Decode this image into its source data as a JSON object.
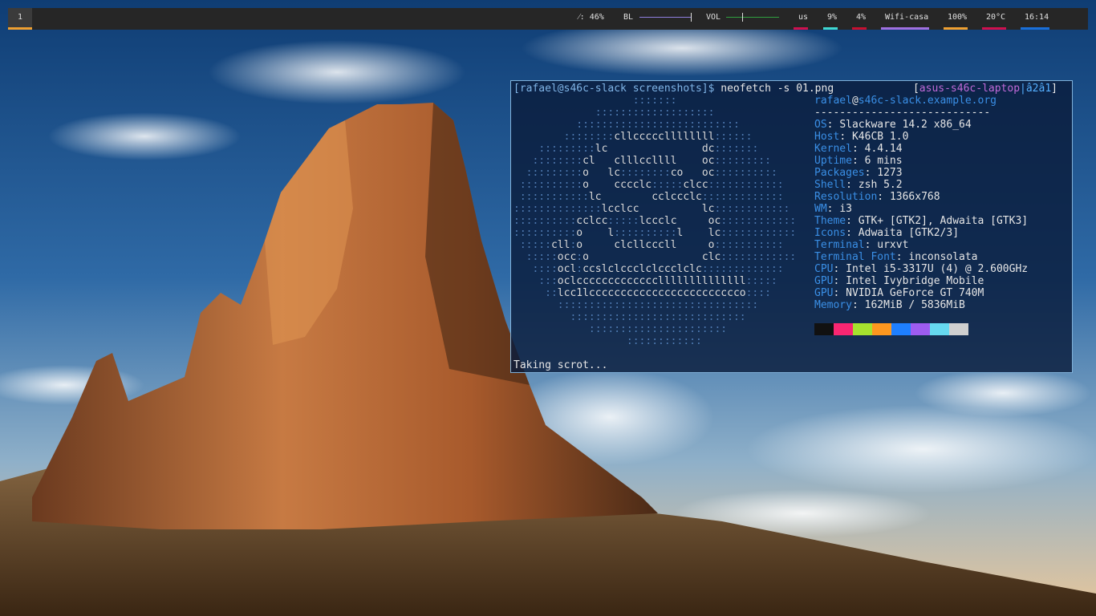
{
  "statusbar": {
    "workspace": "1",
    "brightness": "⁄: 46%",
    "backlight_label": "BL",
    "volume_label": "VOL",
    "keyboard_layout": "us",
    "cpu": "9%",
    "mem": "4%",
    "wifi": "Wifi-casa",
    "battery": "100%",
    "temp": "20°C",
    "clock": "16:14",
    "backlight_level": 1.0,
    "volume_level": 0.3,
    "colors": {
      "workspace_accent": "#f0a030",
      "us": "#d0104c",
      "cpu": "#40d8d0",
      "mem": "#c8102e",
      "wifi": "#a070e0",
      "battery": "#f0a030",
      "temp": "#d0104c",
      "clock": "#1a6fd8",
      "backlight_slider": "#9080e0",
      "volume_slider": "#30a040"
    }
  },
  "terminal": {
    "prompt_user": "[rafael@s46c-slack screenshots]$",
    "command": " neofetch -s 01.png",
    "host_badge_open": "[",
    "host_badge_name": "asus-s46c-laptop",
    "host_badge_sep": "|",
    "host_badge_num": "â2â1",
    "host_badge_close": "]",
    "status_message": "Taking scrot...",
    "ascii_logo": [
      {
        "a": "                   ",
        "b": ":::::::"
      },
      {
        "a": "             ",
        "b": ":::::::::::::::::::"
      },
      {
        "a": "          ",
        "b": "::::::::::::::::::::::::::"
      },
      {
        "a": "        ",
        "b": "::::::::",
        "c": "cllcccccllllllll",
        "e": "::::::"
      },
      {
        "a": "    ",
        "b": ":::::::::",
        "c": "lc               dc",
        "e": ":::::::"
      },
      {
        "a": "   ",
        "b": "::::::::",
        "c": "cl   clllccllll    oc",
        "e": ":::::::::"
      },
      {
        "a": "  ",
        "b": ":::::::::",
        "c": "o   lc",
        "e": "::::::::",
        "f": "co   oc",
        "g": "::::::::::"
      },
      {
        "a": " ",
        "b": "::::::::::",
        "c": "o    cccclc",
        "e": ":::::",
        "f": "clcc",
        "g": "::::::::::::"
      },
      {
        "a": " ",
        "b": ":::::::::::",
        "c": "lc        cclccclc",
        "g": ":::::::::::::"
      },
      {
        "a": "",
        "b": "::::::::::::::",
        "c": "lcclcc          lc",
        "g": "::::::::::::"
      },
      {
        "a": "",
        "b": "::::::::::",
        "c": "cclcc",
        "e": ":::::",
        "f": "lccclc     oc",
        "g": "::::::::::::"
      },
      {
        "a": "",
        "b": "::::::::::",
        "c": "o    l",
        "e": "::::::::::",
        "f": "l    lc",
        "g": "::::::::::::"
      },
      {
        "a": " ",
        "b": ":::::",
        "c": "cll",
        "e": ":",
        "f": "o     clcllcccll     o",
        "g": ":::::::::::"
      },
      {
        "a": "  ",
        "b": ":::::",
        "c": "occ",
        "e": ":",
        "f": "o                  clc",
        "g": "::::::::::::"
      },
      {
        "a": "   ",
        "b": "::::",
        "c": "ocl",
        "e": ":",
        "f": "ccslclccclclccclclc",
        "g": ":::::::::::::"
      },
      {
        "a": "    ",
        "b": ":::",
        "c": "oclcccccccccccccllllllllllllll",
        "g": ":::::"
      },
      {
        "a": "     ",
        "b": "::",
        "c": "lcc1lcccccccccccccccccccccccco",
        "g": "::::"
      },
      {
        "a": "       ",
        "b": "::::::::::::::::::::::::::::::::"
      },
      {
        "a": "         ",
        "b": "::::::::::::::::::::::::::::"
      },
      {
        "a": "            ",
        "b": "::::::::::::::::::::::"
      },
      {
        "a": "                  ",
        "b": "::::::::::::"
      }
    ],
    "info_user": "rafael",
    "info_at": "@",
    "info_host": "s46c-slack.example.org",
    "info_separator": "----------------------------",
    "info": [
      {
        "key": "OS",
        "sep": ": ",
        "value": "Slackware 14.2 x86_64"
      },
      {
        "key": "Host",
        "sep": ": ",
        "value": "K46CB 1.0"
      },
      {
        "key": "Kernel",
        "sep": ": ",
        "value": "4.4.14"
      },
      {
        "key": "Uptime",
        "sep": ": ",
        "value": "6 mins"
      },
      {
        "key": "Packages",
        "sep": ": ",
        "value": "1273"
      },
      {
        "key": "Shell",
        "sep": ": ",
        "value": "zsh 5.2"
      },
      {
        "key": "Resolution",
        "sep": ": ",
        "value": "1366x768"
      },
      {
        "key": "WM",
        "sep": ": ",
        "value": "i3"
      },
      {
        "key": "Theme",
        "sep": ": ",
        "value": "GTK+ [GTK2], Adwaita [GTK3]"
      },
      {
        "key": "Icons",
        "sep": ": ",
        "value": "Adwaita [GTK2/3]"
      },
      {
        "key": "Terminal",
        "sep": ": ",
        "value": "urxvt"
      },
      {
        "key": "Terminal Font",
        "sep": ": ",
        "value": "inconsolata"
      },
      {
        "key": "CPU",
        "sep": ": ",
        "value": "Intel i5-3317U (4) @ 2.600GHz"
      },
      {
        "key": "GPU",
        "sep": ": ",
        "value": "Intel Ivybridge Mobile"
      },
      {
        "key": "GPU",
        "sep": ": ",
        "value": "NVIDIA GeForce GT 740M"
      },
      {
        "key": "Memory",
        "sep": ": ",
        "value": "162MiB / 5836MiB"
      }
    ],
    "palette": [
      "#111111",
      "#f92672",
      "#a6e22e",
      "#fd971f",
      "#1e7fff",
      "#9e5cf0",
      "#66d9ef",
      "#d0d0d0"
    ]
  }
}
